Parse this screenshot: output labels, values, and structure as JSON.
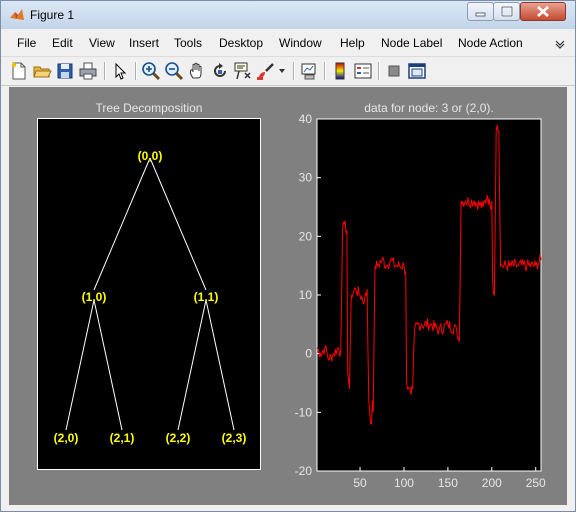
{
  "window": {
    "title": "Figure 1",
    "app_icon": "matlab-icon"
  },
  "titlebar_buttons": [
    "minimize-icon",
    "maximize-icon",
    "close-icon"
  ],
  "menu": {
    "items": [
      "File",
      "Edit",
      "View",
      "Insert",
      "Tools",
      "Desktop",
      "Window",
      "Help",
      "Node Label",
      "Node Action"
    ],
    "overflow_icon": "menu-overflow-icon"
  },
  "toolbar": {
    "icons": [
      "new-figure-icon",
      "open-file-icon",
      "save-icon",
      "print-icon",
      "edit-plot-arrow-icon",
      "zoom-in-icon",
      "zoom-out-icon",
      "pan-hand-icon",
      "rotate-3d-icon",
      "data-cursor-icon",
      "brush-icon",
      "brush-dropdown-icon",
      "link-plot-icon",
      "insert-colorbar-icon",
      "insert-legend-icon",
      "hide-plot-tools-icon",
      "show-plot-tools-icon"
    ]
  },
  "tree_plot": {
    "title": "Tree Decomposition",
    "nodes": [
      "(0,0)",
      "(1,0)",
      "(1,1)",
      "(2,0)",
      "(2,1)",
      "(2,2)",
      "(2,3)"
    ],
    "edges": [
      [
        "(0,0)",
        "(1,0)"
      ],
      [
        "(0,0)",
        "(1,1)"
      ],
      [
        "(1,0)",
        "(2,0)"
      ],
      [
        "(1,0)",
        "(2,1)"
      ],
      [
        "(1,1)",
        "(2,2)"
      ],
      [
        "(1,1)",
        "(2,3)"
      ]
    ],
    "node_color": "#ffff00",
    "edge_color": "#ffffff",
    "background": "#000000"
  },
  "chart_data": {
    "type": "line",
    "title": "data for node: 3 or (2,0).",
    "xlabel": "",
    "ylabel": "",
    "xlim": [
      1,
      256
    ],
    "ylim": [
      -20,
      40
    ],
    "xticks": [
      50,
      100,
      150,
      200,
      250
    ],
    "yticks": [
      -20,
      -10,
      0,
      10,
      20,
      30,
      40
    ],
    "series": [
      {
        "color": "#ff0000",
        "x": [
          1,
          5,
          10,
          15,
          20,
          25,
          28,
          30,
          32,
          35,
          36,
          38,
          40,
          45,
          50,
          55,
          58,
          60,
          61,
          63,
          64,
          65,
          67,
          70,
          75,
          80,
          85,
          90,
          100,
          102,
          103,
          105,
          108,
          110,
          112,
          115,
          120,
          130,
          140,
          150,
          160,
          163,
          165,
          170,
          180,
          190,
          195,
          198,
          200,
          201,
          203,
          205,
          206,
          208,
          210,
          220,
          230,
          240,
          250,
          256
        ],
        "y": [
          1,
          0,
          1,
          -1,
          0,
          1,
          0,
          21,
          22,
          21,
          -3,
          -6,
          10,
          11,
          10,
          9,
          11,
          -8,
          -10,
          -12,
          -8,
          -10,
          15,
          15,
          16,
          15,
          16,
          15,
          15,
          14,
          -5,
          -6,
          -7,
          -6,
          4,
          5,
          5,
          5,
          4,
          5,
          4,
          2,
          26,
          26,
          26,
          25,
          27,
          25,
          26,
          12,
          10,
          38,
          39,
          38,
          15,
          15,
          15,
          15,
          15,
          16
        ]
      }
    ],
    "grid": false,
    "background": "#000000",
    "box": true
  }
}
